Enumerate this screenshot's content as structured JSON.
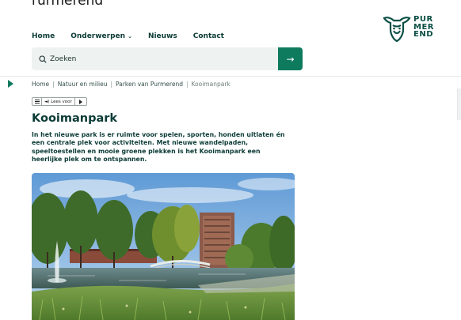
{
  "top_fragment": "rurmerend",
  "logo": {
    "line1": "PUR",
    "line2": "MER",
    "line3": "END",
    "color": "#0b4f45",
    "icon": "cow-head-icon"
  },
  "nav": {
    "home": "Home",
    "onderwerpen": "Onderwerpen",
    "nieuws": "Nieuws",
    "contact": "Contact"
  },
  "search": {
    "placeholder": "Zoeken",
    "submit_icon": "arrow-right-icon",
    "button_color": "#0e7a5e"
  },
  "breadcrumb": {
    "items": [
      "Home",
      "Natuur en milieu",
      "Parken van Purmerend"
    ],
    "current": "Kooimanpark"
  },
  "readspeaker": {
    "label": "Lees voor"
  },
  "page": {
    "title": "Kooimanpark",
    "intro": "In het nieuwe park is er ruimte voor spelen, sporten, honden uitlaten én een centrale plek voor activiteiten. Met nieuwe wandelpaden, speeltoestellen en mooie groene plekken is het Kooimanpark een heerlijke plek om te ontspannen."
  },
  "colors": {
    "text": "#0b3b36",
    "accent": "#0e7a5e",
    "search_bg": "#eef3f1"
  }
}
